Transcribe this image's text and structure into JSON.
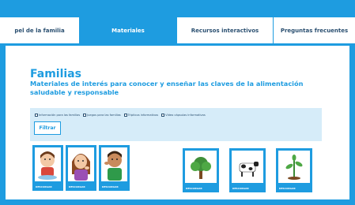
{
  "tabs": [
    {
      "label": "pel de la familia",
      "active": false
    },
    {
      "label": "Materiales",
      "active": true
    },
    {
      "label": "Recursos interactivos",
      "active": false
    },
    {
      "label": "Preguntas frecuentes",
      "active": false
    }
  ],
  "main": {
    "title": "Familias",
    "subtitle": "Materiales de interés para conocer y enseñar las claves de la alimentación saludable y responsable"
  },
  "filter": {
    "options": [
      {
        "label": "Información para las familias",
        "checked": false
      },
      {
        "label": "Juegos para las familias",
        "checked": false
      },
      {
        "label": "Trípticos informativos",
        "checked": false
      },
      {
        "label": "Vídeo cápsulas informativas",
        "checked": false
      }
    ],
    "button_label": "Filtrar"
  },
  "cards": [
    {
      "label": "DESCARGAR",
      "icon": "child-eating-icon"
    },
    {
      "label": "DESCARGAR",
      "icon": "girl-thinking-icon"
    },
    {
      "label": "DESCARGAR",
      "icon": "child-touching-face-icon"
    },
    {
      "label": "DESCARGAR",
      "icon": "tree-icon"
    },
    {
      "label": "DESCARGAR",
      "icon": "cow-icon"
    },
    {
      "label": "DESCARGAR",
      "icon": "plant-sprout-icon"
    }
  ],
  "colors": {
    "accent": "#1e9ce0",
    "panel": "#d6ecf9",
    "text_dark": "#2a4f70"
  }
}
